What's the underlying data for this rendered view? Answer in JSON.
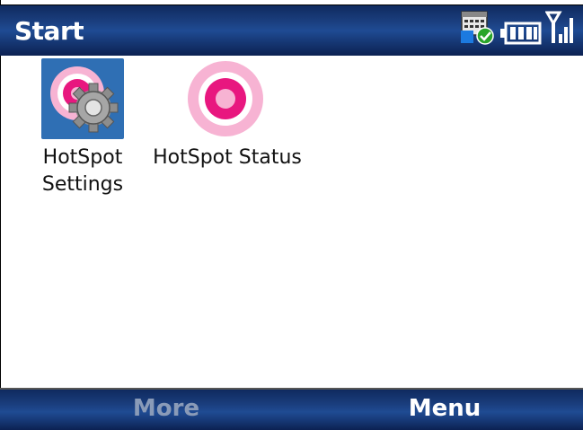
{
  "title_bar": {
    "title": "Start",
    "status_icons": [
      "calendar-check-icon",
      "battery-icon",
      "signal-icon"
    ]
  },
  "apps": [
    {
      "label_line1": "HotSpot",
      "label_line2": "Settings",
      "icon": "hotspot-settings-icon",
      "selected": true
    },
    {
      "label": "HotSpot Status",
      "icon": "hotspot-status-icon",
      "selected": false
    }
  ],
  "soft_keys": {
    "left": "More",
    "right": "Menu"
  },
  "colors": {
    "bar_blue": "#1f4b93",
    "hotspot_pink": "#e8177f",
    "selection_blue": "#2f6fb4",
    "soft_key_disabled": "#8a9bb8"
  }
}
